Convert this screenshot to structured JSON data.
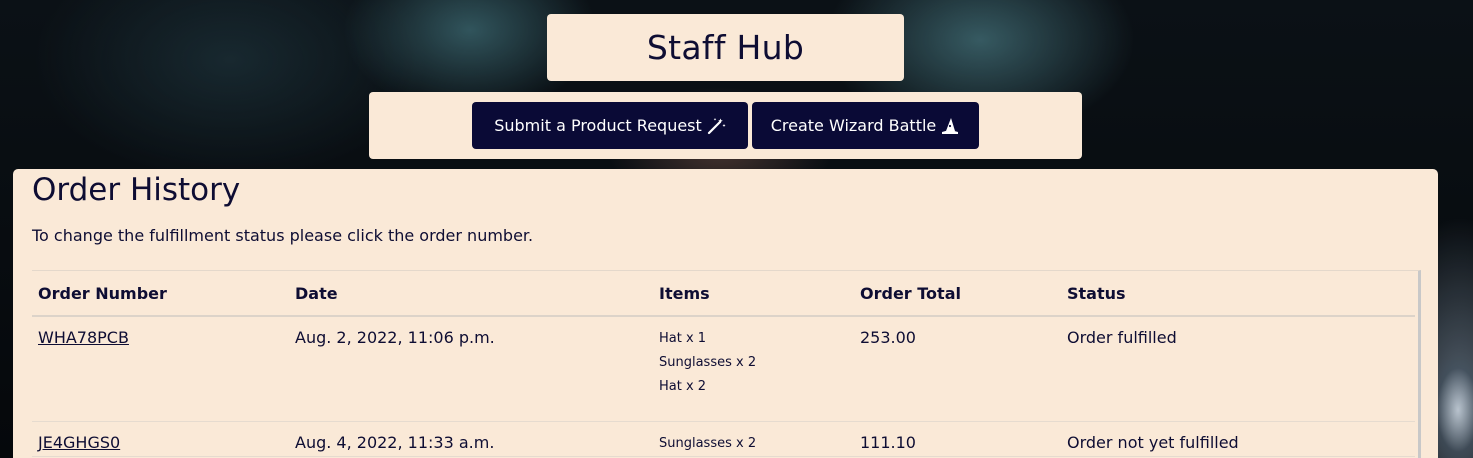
{
  "header": {
    "title": "Staff Hub"
  },
  "actions": {
    "request_label": "Submit a Product Request",
    "battle_label": "Create Wizard Battle",
    "request_icon": "magic-wand-icon",
    "battle_icon": "wizard-hat-icon"
  },
  "orders": {
    "heading": "Order History",
    "note": "To change the fulfillment status please click the order number.",
    "columns": [
      "Order Number",
      "Date",
      "Items",
      "Order Total",
      "Status"
    ],
    "rows": [
      {
        "number": "WHA78PCB",
        "date": "Aug. 2, 2022, 11:06 p.m.",
        "items": [
          "Hat x 1",
          "Sunglasses x 2",
          "Hat x 2"
        ],
        "total": "253.00",
        "status": "Order fulfilled"
      },
      {
        "number": "JE4GHGS0",
        "date": "Aug. 4, 2022, 11:33 a.m.",
        "items": [
          "Sunglasses x 2"
        ],
        "total": "111.10",
        "status": "Order not yet fulfilled"
      }
    ]
  },
  "colors": {
    "panel": "#fae9d7",
    "button": "#0a0a36",
    "text": "#0e0d33"
  }
}
